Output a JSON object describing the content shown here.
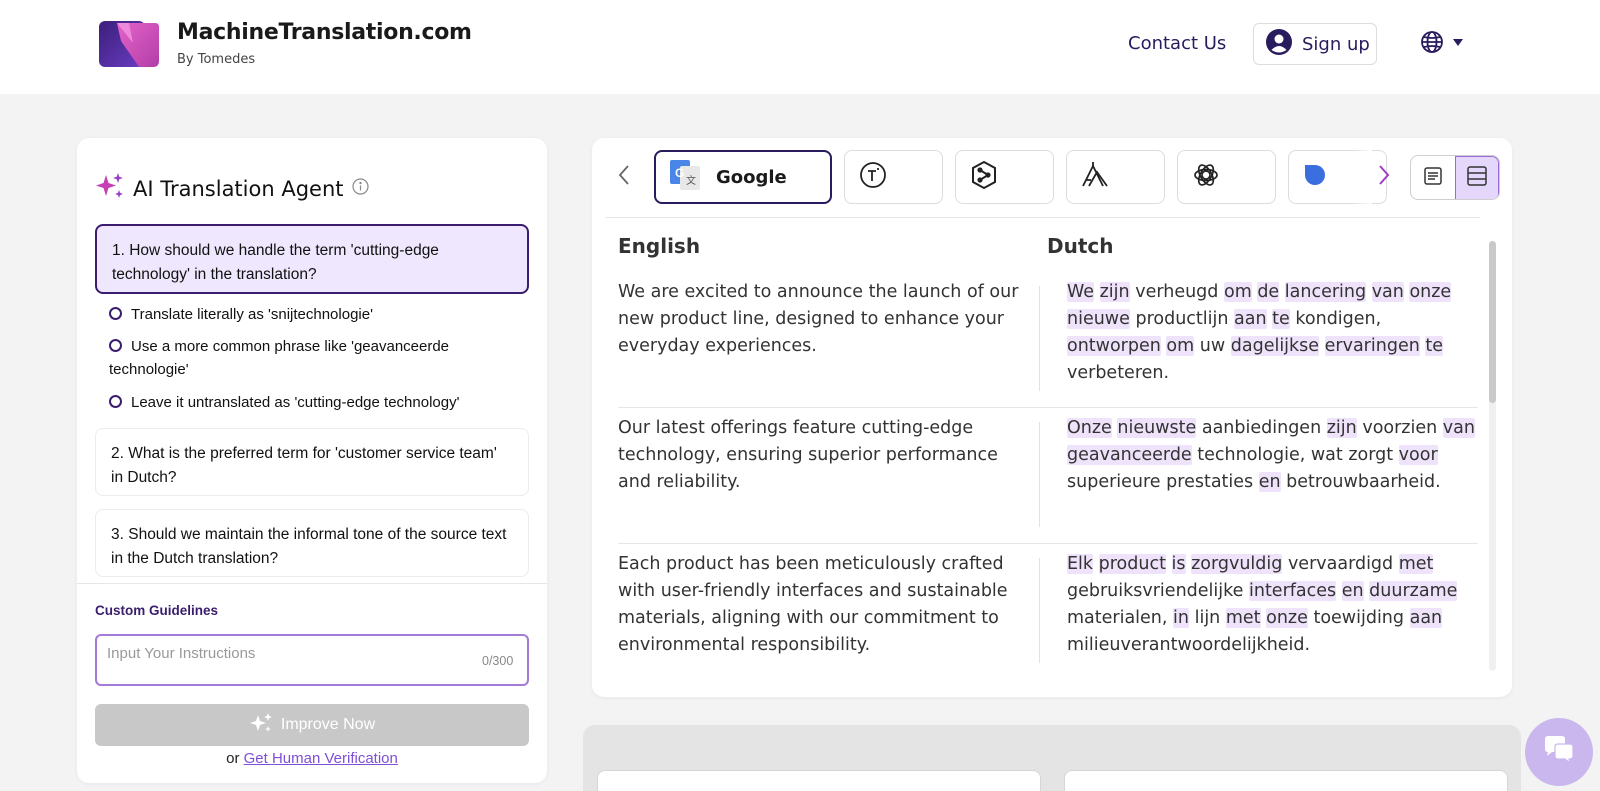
{
  "header": {
    "brand_title": "MachineTranslation.com",
    "brand_sub": "By Tomedes",
    "contact_label": "Contact Us",
    "signup_label": "Sign up",
    "icons": {
      "logo": "brand-logo",
      "user": "user-circle-icon",
      "language": "globe-icon",
      "dropdown": "caret-down-icon"
    }
  },
  "agent": {
    "title": "AI Translation Agent",
    "questions": [
      {
        "text": "1. How should we handle the term 'cutting-edge technology' in the translation?"
      },
      {
        "text": "2. What is the preferred term for 'customer service team' in Dutch?"
      },
      {
        "text": "3. Should we maintain the informal tone of the source text in the Dutch translation?"
      }
    ],
    "options": [
      "Translate literally as 'snijtechnologie'",
      "Use a more common phrase like 'geavanceerde technologie'",
      "Leave it untranslated as 'cutting-edge technology'"
    ],
    "custom_label": "Custom Guidelines",
    "input_placeholder": "Input Your Instructions",
    "input_value": "",
    "char_count": "0/300",
    "improve_label": "Improve Now",
    "verify_prefix": "or",
    "verify_link": "Get Human Verification"
  },
  "translation": {
    "engines": [
      {
        "name": "Google",
        "icon": "google-translate-icon",
        "active": true
      },
      {
        "name": "",
        "icon": "engine-t-icon",
        "active": false
      },
      {
        "name": "",
        "icon": "engine-deepl-icon",
        "active": false
      },
      {
        "name": "",
        "icon": "engine-mountain-icon",
        "active": false
      },
      {
        "name": "",
        "icon": "chatgpt-icon",
        "active": false
      },
      {
        "name": "",
        "icon": "engine-blue-icon",
        "active": false
      }
    ],
    "source_lang": "English",
    "target_lang": "Dutch",
    "segments": [
      {
        "source": "We are excited to announce the launch of our new product line, designed to enhance your everyday experiences.",
        "target": [
          {
            "t": "We",
            "h": true
          },
          {
            "t": "zijn",
            "h": true
          },
          {
            "t": "verheugd",
            "h": false
          },
          {
            "t": "om",
            "h": true
          },
          {
            "t": "de",
            "h": true
          },
          {
            "t": "lancering",
            "h": true
          },
          {
            "t": "van",
            "h": true
          },
          {
            "t": "onze",
            "h": true
          },
          {
            "t": "nieuwe",
            "h": true
          },
          {
            "t": "productlijn",
            "h": false
          },
          {
            "t": "aan",
            "h": true
          },
          {
            "t": "te",
            "h": true
          },
          {
            "t": "kondigen,",
            "h": false
          },
          {
            "t": "ontworpen",
            "h": true
          },
          {
            "t": "om",
            "h": true
          },
          {
            "t": "uw",
            "h": false
          },
          {
            "t": "dagelijkse",
            "h": true
          },
          {
            "t": "ervaringen",
            "h": true
          },
          {
            "t": "te",
            "h": true
          },
          {
            "t": "verbeteren.",
            "h": false
          }
        ]
      },
      {
        "source": "Our latest offerings feature cutting-edge technology, ensuring superior performance and reliability.",
        "target": [
          {
            "t": "Onze",
            "h": true
          },
          {
            "t": "nieuwste",
            "h": true
          },
          {
            "t": "aanbiedingen",
            "h": false
          },
          {
            "t": "zijn",
            "h": true
          },
          {
            "t": "voorzien",
            "h": false
          },
          {
            "t": "van",
            "h": true
          },
          {
            "t": "geavanceerde",
            "h": true
          },
          {
            "t": "technologie,",
            "h": false
          },
          {
            "t": "wat",
            "h": false
          },
          {
            "t": "zorgt",
            "h": false
          },
          {
            "t": "voor",
            "h": true
          },
          {
            "t": "superieure",
            "h": false
          },
          {
            "t": "prestaties",
            "h": false
          },
          {
            "t": "en",
            "h": true
          },
          {
            "t": "betrouwbaarheid.",
            "h": false
          }
        ]
      },
      {
        "source": "Each product has been meticulously crafted with user-friendly interfaces and sustainable materials, aligning with our commitment to environmental responsibility.",
        "target": [
          {
            "t": "Elk",
            "h": true
          },
          {
            "t": "product",
            "h": true
          },
          {
            "t": "is",
            "h": true
          },
          {
            "t": "zorgvuldig",
            "h": true
          },
          {
            "t": "vervaardigd",
            "h": false
          },
          {
            "t": "met",
            "h": true
          },
          {
            "t": "gebruiksvriendelijke",
            "h": false
          },
          {
            "t": "interfaces",
            "h": true
          },
          {
            "t": "en",
            "h": true
          },
          {
            "t": "duurzame",
            "h": true
          },
          {
            "t": "materialen,",
            "h": false
          },
          {
            "t": "in",
            "h": true
          },
          {
            "t": "lijn",
            "h": false
          },
          {
            "t": "met",
            "h": true
          },
          {
            "t": "onze",
            "h": true
          },
          {
            "t": "toewijding",
            "h": false
          },
          {
            "t": "aan",
            "h": true
          },
          {
            "t": "milieuverantwoordelijkheid.",
            "h": false
          }
        ]
      }
    ]
  },
  "colors": {
    "brand_dark": "#2a1a5e",
    "accent_purple": "#7f4fd6",
    "highlight": "#efe3fb",
    "active_question_bg": "#efe7fd"
  }
}
